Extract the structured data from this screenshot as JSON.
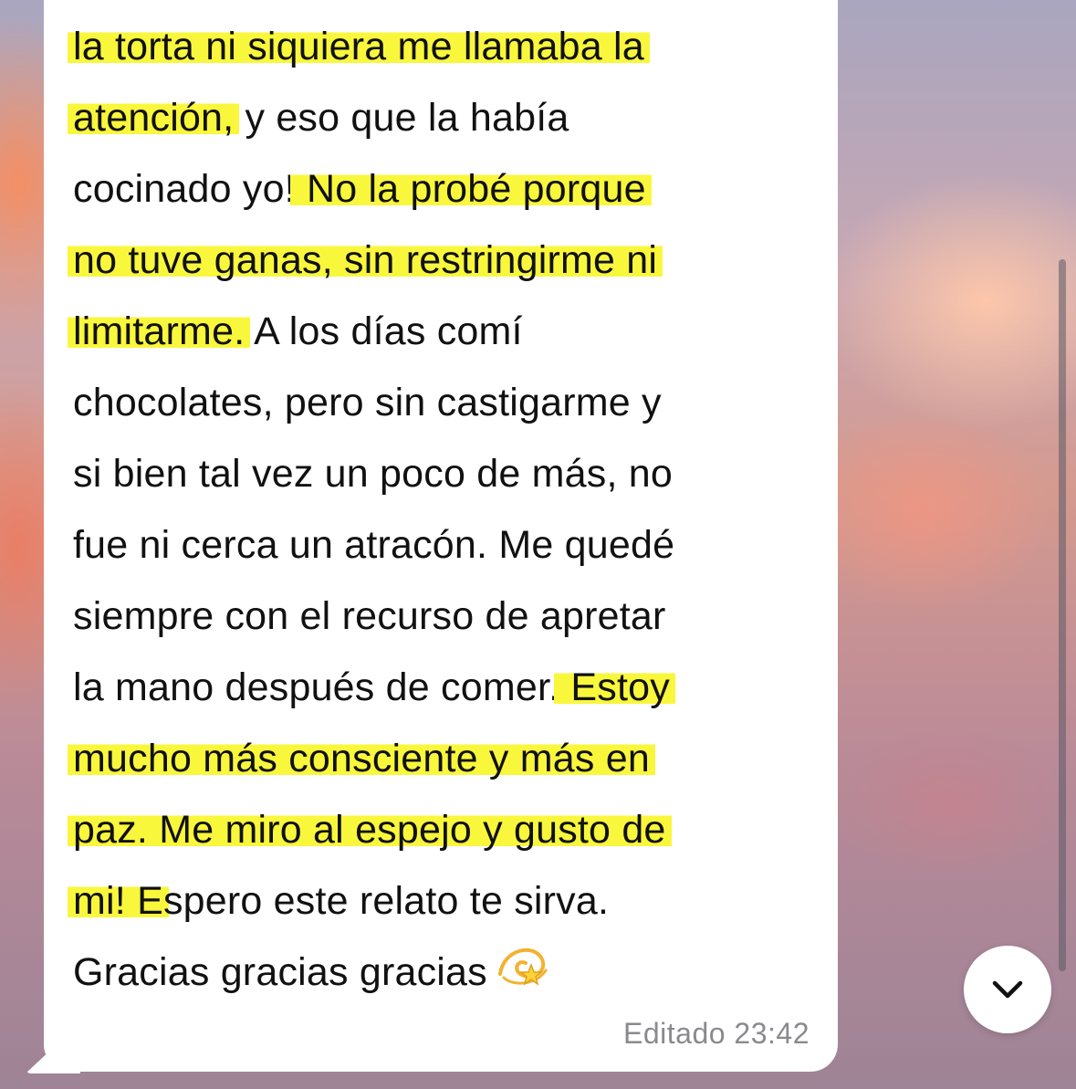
{
  "message": {
    "lines": [
      {
        "parts": [
          {
            "text": "la torta ni siquiera me llamaba la",
            "hl": true
          }
        ]
      },
      {
        "parts": [
          {
            "text": "atención,",
            "hl": true
          },
          {
            "text": " y eso que la había",
            "hl": false
          }
        ]
      },
      {
        "parts": [
          {
            "text": "cocinado yo!",
            "hl": false
          },
          {
            "text": " No la probé porque",
            "hl": true
          }
        ]
      },
      {
        "parts": [
          {
            "text": "no tuve ganas, sin restringirme ni",
            "hl": true
          }
        ]
      },
      {
        "parts": [
          {
            "text": "limitarme.",
            "hl": true
          },
          {
            "text": " A los días comí",
            "hl": false
          }
        ]
      },
      {
        "parts": [
          {
            "text": "chocolates, pero sin castigarme y",
            "hl": false
          }
        ]
      },
      {
        "parts": [
          {
            "text": "si bien tal vez un poco de más, no",
            "hl": false
          }
        ]
      },
      {
        "parts": [
          {
            "text": "fue ni cerca un atracón. Me quedé",
            "hl": false
          }
        ]
      },
      {
        "parts": [
          {
            "text": "siempre con el recurso de apretar",
            "hl": false
          }
        ]
      },
      {
        "parts": [
          {
            "text": "la mano después de comer.",
            "hl": false
          },
          {
            "text": " Estoy",
            "hl": true
          }
        ]
      },
      {
        "parts": [
          {
            "text": "mucho más consciente y más en",
            "hl": true
          }
        ]
      },
      {
        "parts": [
          {
            "text": "paz. Me miro al espejo y gusto de",
            "hl": true
          }
        ]
      },
      {
        "parts": [
          {
            "text": "mi! E",
            "hl": true
          },
          {
            "text": "spero este relato te sirva.",
            "hl": false
          }
        ]
      },
      {
        "parts": [
          {
            "text": "Gracias gracias gracias",
            "hl": false
          }
        ]
      }
    ],
    "emoji": "dizzy-icon",
    "meta": "Editado 23:42"
  },
  "scroll_button": {
    "icon": "chevron-down-icon"
  },
  "colors": {
    "highlight": "#f9f73c",
    "bubble": "#ffffff",
    "meta_text": "#8a8a8e"
  }
}
